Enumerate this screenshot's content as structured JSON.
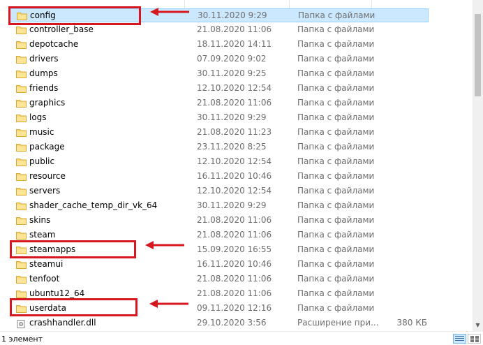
{
  "files": [
    {
      "name": "config",
      "date": "30.11.2020 9:29",
      "type": "Папка с файлами",
      "size": "",
      "kind": "folder",
      "selected": true
    },
    {
      "name": "controller_base",
      "date": "21.08.2020 11:06",
      "type": "Папка с файлами",
      "size": "",
      "kind": "folder"
    },
    {
      "name": "depotcache",
      "date": "18.11.2020 14:11",
      "type": "Папка с файлами",
      "size": "",
      "kind": "folder"
    },
    {
      "name": "drivers",
      "date": "07.09.2020 9:02",
      "type": "Папка с файлами",
      "size": "",
      "kind": "folder"
    },
    {
      "name": "dumps",
      "date": "30.11.2020 9:25",
      "type": "Папка с файлами",
      "size": "",
      "kind": "folder"
    },
    {
      "name": "friends",
      "date": "12.10.2020 12:54",
      "type": "Папка с файлами",
      "size": "",
      "kind": "folder"
    },
    {
      "name": "graphics",
      "date": "21.08.2020 11:06",
      "type": "Папка с файлами",
      "size": "",
      "kind": "folder"
    },
    {
      "name": "logs",
      "date": "30.11.2020 9:29",
      "type": "Папка с файлами",
      "size": "",
      "kind": "folder"
    },
    {
      "name": "music",
      "date": "21.08.2020 11:23",
      "type": "Папка с файлами",
      "size": "",
      "kind": "folder"
    },
    {
      "name": "package",
      "date": "23.11.2020 8:25",
      "type": "Папка с файлами",
      "size": "",
      "kind": "folder"
    },
    {
      "name": "public",
      "date": "12.10.2020 12:54",
      "type": "Папка с файлами",
      "size": "",
      "kind": "folder"
    },
    {
      "name": "resource",
      "date": "16.11.2020 10:46",
      "type": "Папка с файлами",
      "size": "",
      "kind": "folder"
    },
    {
      "name": "servers",
      "date": "12.10.2020 12:54",
      "type": "Папка с файлами",
      "size": "",
      "kind": "folder"
    },
    {
      "name": "shader_cache_temp_dir_vk_64",
      "date": "30.11.2020 9:29",
      "type": "Папка с файлами",
      "size": "",
      "kind": "folder"
    },
    {
      "name": "skins",
      "date": "21.08.2020 11:06",
      "type": "Папка с файлами",
      "size": "",
      "kind": "folder"
    },
    {
      "name": "steam",
      "date": "21.08.2020 11:06",
      "type": "Папка с файлами",
      "size": "",
      "kind": "folder"
    },
    {
      "name": "steamapps",
      "date": "15.09.2020 16:55",
      "type": "Папка с файлами",
      "size": "",
      "kind": "folder"
    },
    {
      "name": "steamui",
      "date": "16.11.2020 10:46",
      "type": "Папка с файлами",
      "size": "",
      "kind": "folder"
    },
    {
      "name": "tenfoot",
      "date": "21.08.2020 11:06",
      "type": "Папка с файлами",
      "size": "",
      "kind": "folder"
    },
    {
      "name": "ubuntu12_64",
      "date": "21.08.2020 11:06",
      "type": "Папка с файлами",
      "size": "",
      "kind": "folder"
    },
    {
      "name": "userdata",
      "date": "09.11.2020 12:16",
      "type": "Папка с файлами",
      "size": "",
      "kind": "folder"
    },
    {
      "name": "crashhandler.dll",
      "date": "29.10.2020 3:56",
      "type": "Расширение при...",
      "size": "380 КБ",
      "kind": "dll"
    }
  ],
  "highlighted_rows": [
    0,
    16,
    20
  ],
  "annotation_color": "#d6171f",
  "status_bar": {
    "item_count": "1 элемент"
  }
}
